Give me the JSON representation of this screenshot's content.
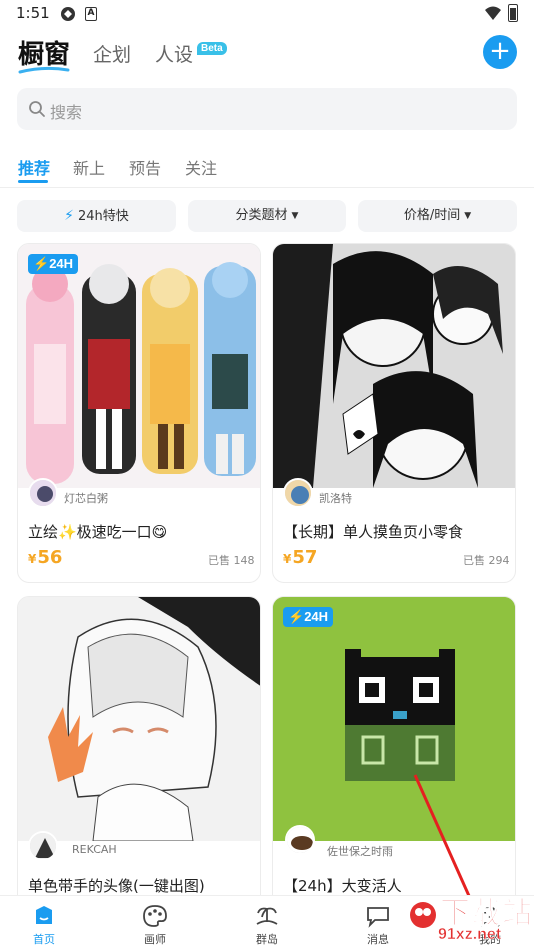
{
  "status": {
    "time": "1:51",
    "notif_letter": "A"
  },
  "header": {
    "brand": "橱窗",
    "tabs": [
      "企划",
      "人设"
    ],
    "beta": "Beta",
    "add_icon": "plus-icon"
  },
  "search": {
    "placeholder": "搜索"
  },
  "sub_tabs": [
    "推荐",
    "新上",
    "预告",
    "关注"
  ],
  "filters": {
    "fast": "24h特快",
    "category": "分类题材",
    "price_time": "价格/时间"
  },
  "cards": [
    {
      "badge": "24H",
      "artist": "灯芯白粥",
      "title": "立绘✨极速吃一口😋",
      "price": "56",
      "currency": "¥",
      "sold": "已售 148"
    },
    {
      "artist": "凯洛特",
      "title": "【长期】单人摸鱼页小零食",
      "price": "57",
      "currency": "¥",
      "sold": "已售 294"
    },
    {
      "artist": "REKCAH",
      "title": "单色带手的头像(一键出图)"
    },
    {
      "badge": "24H",
      "artist": "佐世保之时雨",
      "title": "【24h】大变活人"
    }
  ],
  "nav": [
    {
      "label": "首页",
      "icon": "home-icon",
      "active": true
    },
    {
      "label": "画师",
      "icon": "palette-icon"
    },
    {
      "label": "群岛",
      "icon": "island-icon"
    },
    {
      "label": "消息",
      "icon": "message-icon"
    },
    {
      "label": "我的",
      "icon": "profile-icon"
    }
  ],
  "watermark": {
    "big": "下载站",
    "small": "91xz.net"
  },
  "colors": {
    "accent": "#1a9cf0",
    "price": "#f5a623",
    "watermark": "#e33030"
  }
}
